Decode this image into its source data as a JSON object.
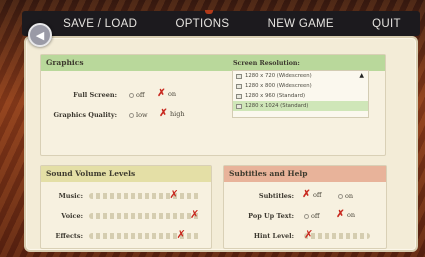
{
  "menu": {
    "save_load": "SAVE / LOAD",
    "options": "OPTIONS",
    "new_game": "NEW GAME",
    "quit": "QUIT"
  },
  "graphics": {
    "title": "Graphics",
    "full_screen_label": "Full Screen:",
    "full_screen_off": "off",
    "full_screen_on": "on",
    "quality_label": "Graphics Quality:",
    "quality_low": "low",
    "quality_high": "high",
    "resolution_label": "Screen Resolution:",
    "resolutions": [
      "1280 x 720 (Widescreen)",
      "1280 x 800 (Widescreen)",
      "1280 x 960 (Standard)",
      "1280 x 1024 (Standard)"
    ],
    "selected_resolution": "1280 x 1024 (Standard)"
  },
  "sound": {
    "title": "Sound Volume Levels",
    "music_label": "Music:",
    "voice_label": "Voice:",
    "effects_label": "Effects:",
    "music_level": 0.78,
    "voice_level": 0.98,
    "effects_level": 0.85
  },
  "help": {
    "title": "Subtitles and Help",
    "subtitles_label": "Subtitles:",
    "subtitles_off": "off",
    "subtitles_on": "on",
    "popup_label": "Pop Up Text:",
    "popup_off": "off",
    "popup_on": "on",
    "hint_label": "Hint Level:",
    "hint_level": 0.0
  },
  "colors": {
    "graphics_header": "#b9d89b",
    "sound_header": "#e4dfa6",
    "help_header": "#e8b39a",
    "mark": "#c8281e"
  }
}
